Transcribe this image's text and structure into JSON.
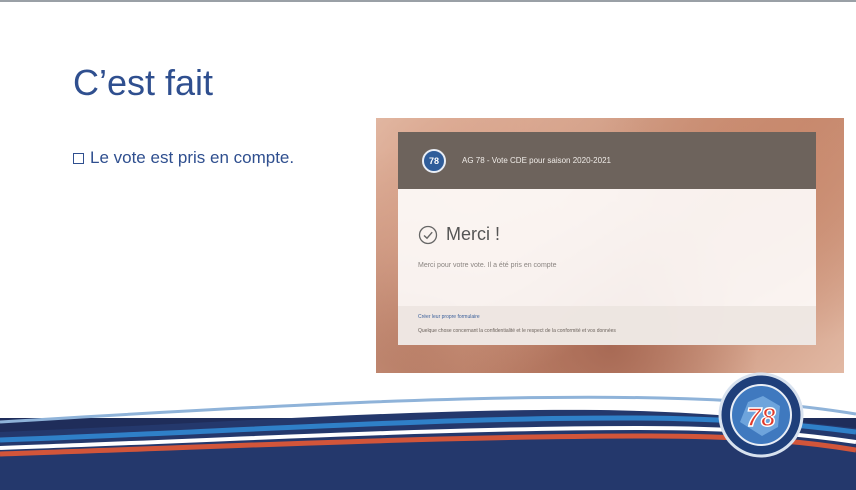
{
  "slide": {
    "title": "C’est fait",
    "bullet": "Le vote est pris en compte."
  },
  "screenshot": {
    "header_title": "AG 78 - Vote CDE pour saison 2020-2021",
    "logo_text": "78",
    "merci": "Merci !",
    "message": "Merci pour votre vote. Il a été pris en compte",
    "footer_link": "Créer leur propre formulaire",
    "footer_text": "Quelque chose concernant la confidentialité et le respect de la conformité et vos données"
  },
  "badge": {
    "number": "78"
  },
  "colors": {
    "title_blue": "#2f4f8f",
    "header_brown": "#6d635c",
    "wave_navy": "#1f2d5a",
    "wave_orange": "#d2553a",
    "wave_blue": "#2f80c8"
  }
}
